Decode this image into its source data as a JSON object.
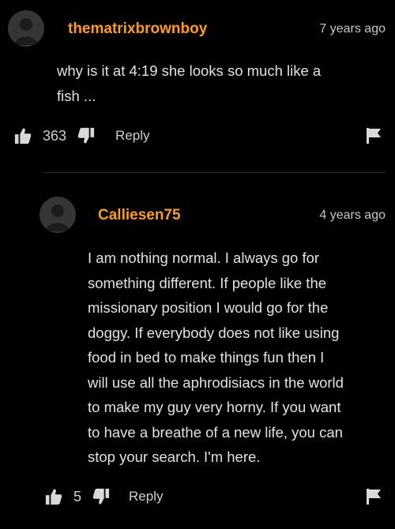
{
  "comments": [
    {
      "username": "thematrixbrownboy",
      "time": "7 years ago",
      "lines": [
        "why is it at 4:19 she looks so much like a",
        "fish ..."
      ],
      "likes": "363",
      "reply_label": "Reply"
    },
    {
      "username": "Calliesen75",
      "time": "4 years ago",
      "lines": [
        "I am nothing normal. I always go for",
        "something different. If people like the",
        "missionary position I would go for the",
        "doggy. If everybody does not like using",
        "food in bed to make things fun then I",
        "will use all the aphrodisiacs in the world",
        "to make my guy very horny. If you want",
        "to have a breathe of a new life, you can",
        "stop your search. I'm here."
      ],
      "likes": "5",
      "reply_label": "Reply"
    }
  ],
  "icons": {
    "avatar": "default-avatar-icon",
    "like": "thumbs-up-icon",
    "dislike": "thumbs-down-icon",
    "report": "flag-icon"
  },
  "colors": {
    "background": "#000000",
    "username": "#ff9d1f",
    "text": "#e2e2e2",
    "muted": "#cfcfcf",
    "avatar": "#353535"
  }
}
